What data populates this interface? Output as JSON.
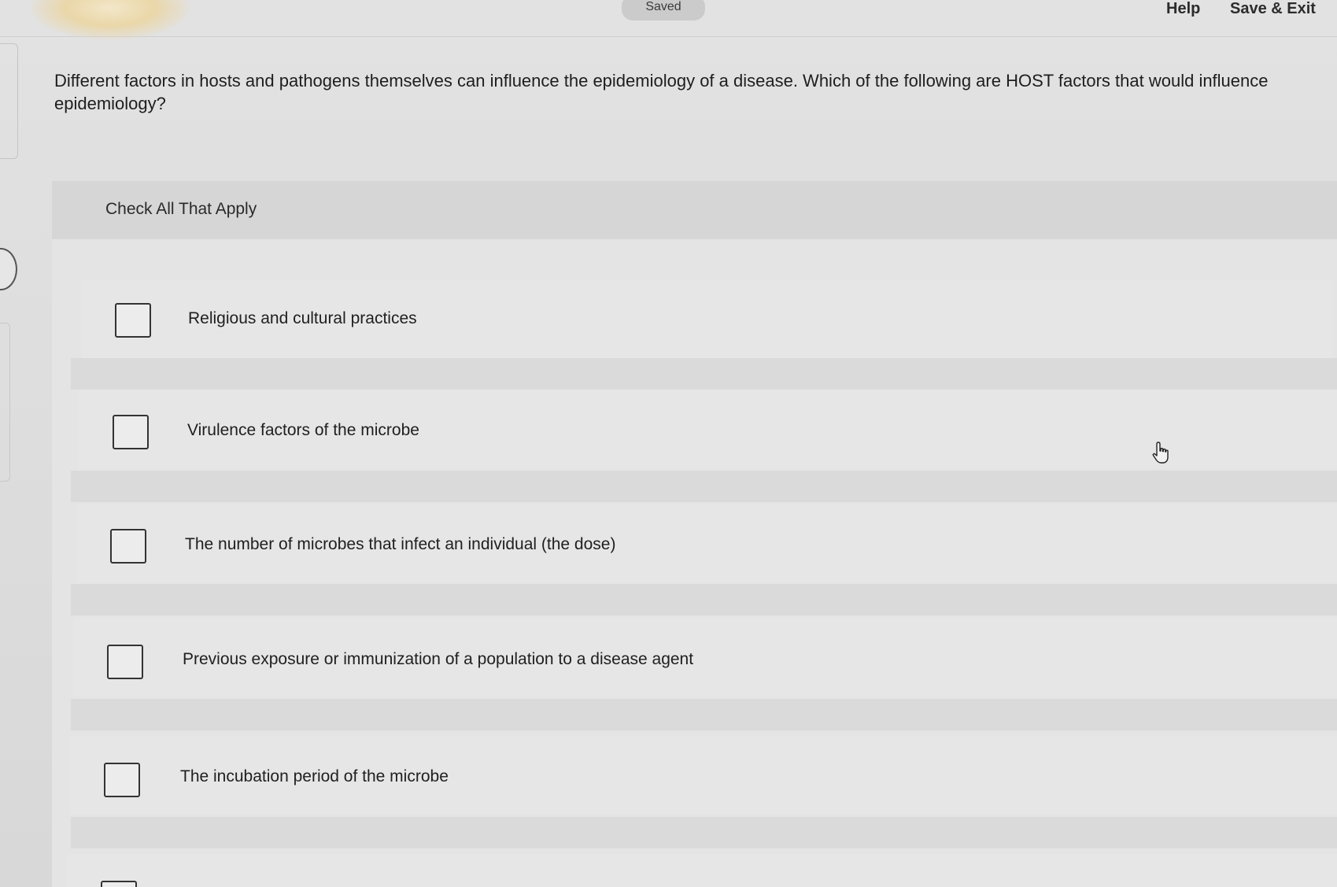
{
  "header": {
    "status": "Saved",
    "help_label": "Help",
    "save_exit_label": "Save & Exit"
  },
  "question": {
    "prompt": "Different factors in hosts and pathogens themselves can influence the epidemiology of a disease. Which of the following are HOST factors that would influence epidemiology?",
    "instruction": "Check All That Apply"
  },
  "options": [
    {
      "label": "Religious and cultural practices",
      "checked": false
    },
    {
      "label": "Virulence factors of the microbe",
      "checked": false
    },
    {
      "label": "The number of microbes that infect an individual (the dose)",
      "checked": false
    },
    {
      "label": "Previous exposure or immunization of a population to a disease agent",
      "checked": false
    },
    {
      "label": "The incubation period of the microbe",
      "checked": false
    }
  ],
  "icons": {
    "pointer": "hand-pointer-icon"
  }
}
